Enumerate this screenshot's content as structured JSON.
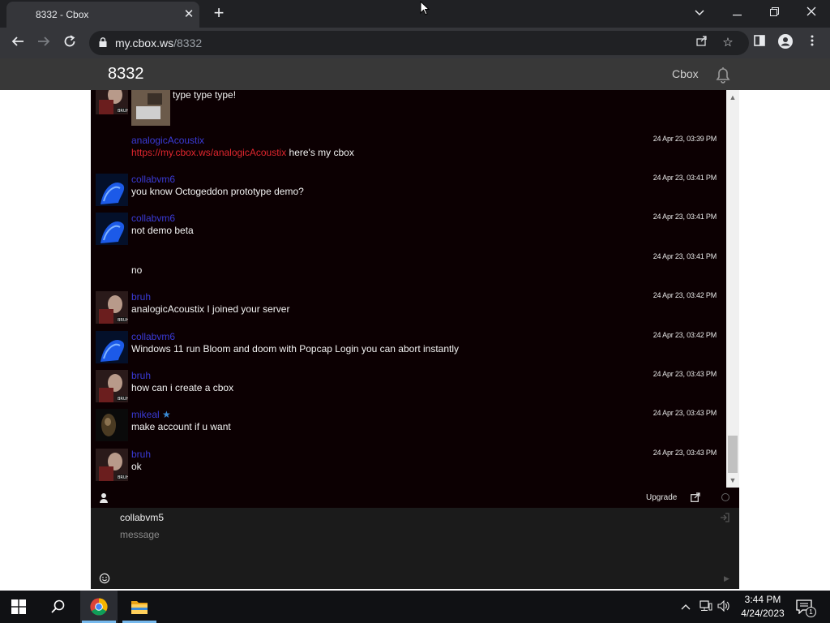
{
  "browser": {
    "tab_title": "8332 - Cbox",
    "url_host": "my.cbox.ws",
    "url_path": "/8332"
  },
  "cbox": {
    "title": "8332",
    "brand": "Cbox"
  },
  "messages": [
    {
      "user": "",
      "text": "type type type!",
      "time": "",
      "avatar": "bruh-avatar",
      "has_image": true
    },
    {
      "user": "analogicAcoustix",
      "link": "https://my.cbox.ws/analogicAcoustix",
      "text": " here's my cbox",
      "time": "24 Apr 23, 03:39 PM",
      "avatar": ""
    },
    {
      "user": "collabvm6",
      "text": "you know Octogeddon prototype demo?",
      "time": "24 Apr 23, 03:41 PM",
      "avatar": "collabvm-avatar"
    },
    {
      "user": "collabvm6",
      "text": "not demo beta",
      "time": "24 Apr 23, 03:41 PM",
      "avatar": "collabvm-avatar"
    },
    {
      "user": "",
      "text": "no",
      "time": "24 Apr 23, 03:41 PM",
      "avatar": ""
    },
    {
      "user": "bruh",
      "text": "analogicAcoustix I joined your server",
      "time": "24 Apr 23, 03:42 PM",
      "avatar": "bruh-avatar"
    },
    {
      "user": "collabvm6",
      "text": "Windows 11 run Bloom and doom with Popcap Login you can abort instantly",
      "time": "24 Apr 23, 03:42 PM",
      "avatar": "collabvm-avatar"
    },
    {
      "user": "bruh",
      "text": "how can i create a cbox",
      "time": "24 Apr 23, 03:43 PM",
      "avatar": "bruh-avatar"
    },
    {
      "user": "mikeal",
      "text": "make account if u want",
      "time": "24 Apr 23, 03:43 PM",
      "avatar": "mikeal-avatar",
      "starred": true
    },
    {
      "user": "bruh",
      "text": "ok",
      "time": "24 Apr 23, 03:43 PM",
      "avatar": "bruh-avatar"
    }
  ],
  "chat_bar": {
    "upgrade_label": "Upgrade"
  },
  "compose": {
    "username": "collabvm5",
    "placeholder": "message"
  },
  "taskbar": {
    "time": "3:44 PM",
    "date": "4/24/2023",
    "notification_count": "1"
  },
  "colors": {
    "chat_bg": "#0c0002",
    "username": "#3a3ad6",
    "link": "#e0262e",
    "header_bg": "#383838"
  }
}
